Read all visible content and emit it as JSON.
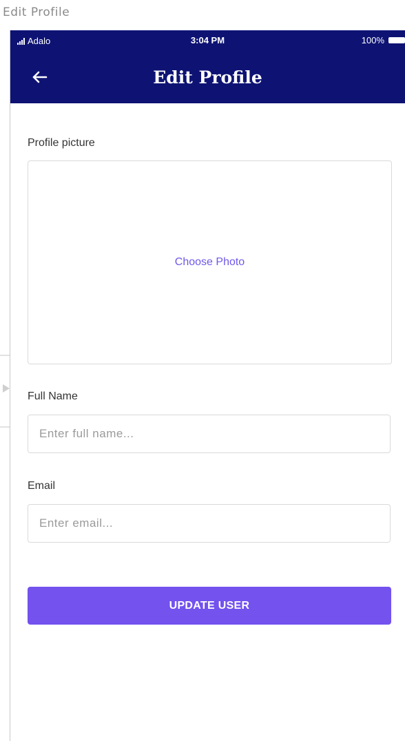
{
  "screen_title": "Edit Profile",
  "status_bar": {
    "carrier": "Adalo",
    "time": "3:04 PM",
    "battery": "100%"
  },
  "app_bar": {
    "title": "Edit Profile",
    "back_icon": "arrow-left-icon"
  },
  "form": {
    "profile_picture": {
      "label": "Profile picture",
      "action": "Choose Photo"
    },
    "full_name": {
      "label": "Full Name",
      "placeholder": "Enter full name...",
      "value": ""
    },
    "email": {
      "label": "Email",
      "placeholder": "Enter email...",
      "value": ""
    },
    "submit_label": "UPDATE USER"
  },
  "colors": {
    "header_bg": "#0e1373",
    "accent": "#7352ee",
    "link": "#6f58e8"
  }
}
